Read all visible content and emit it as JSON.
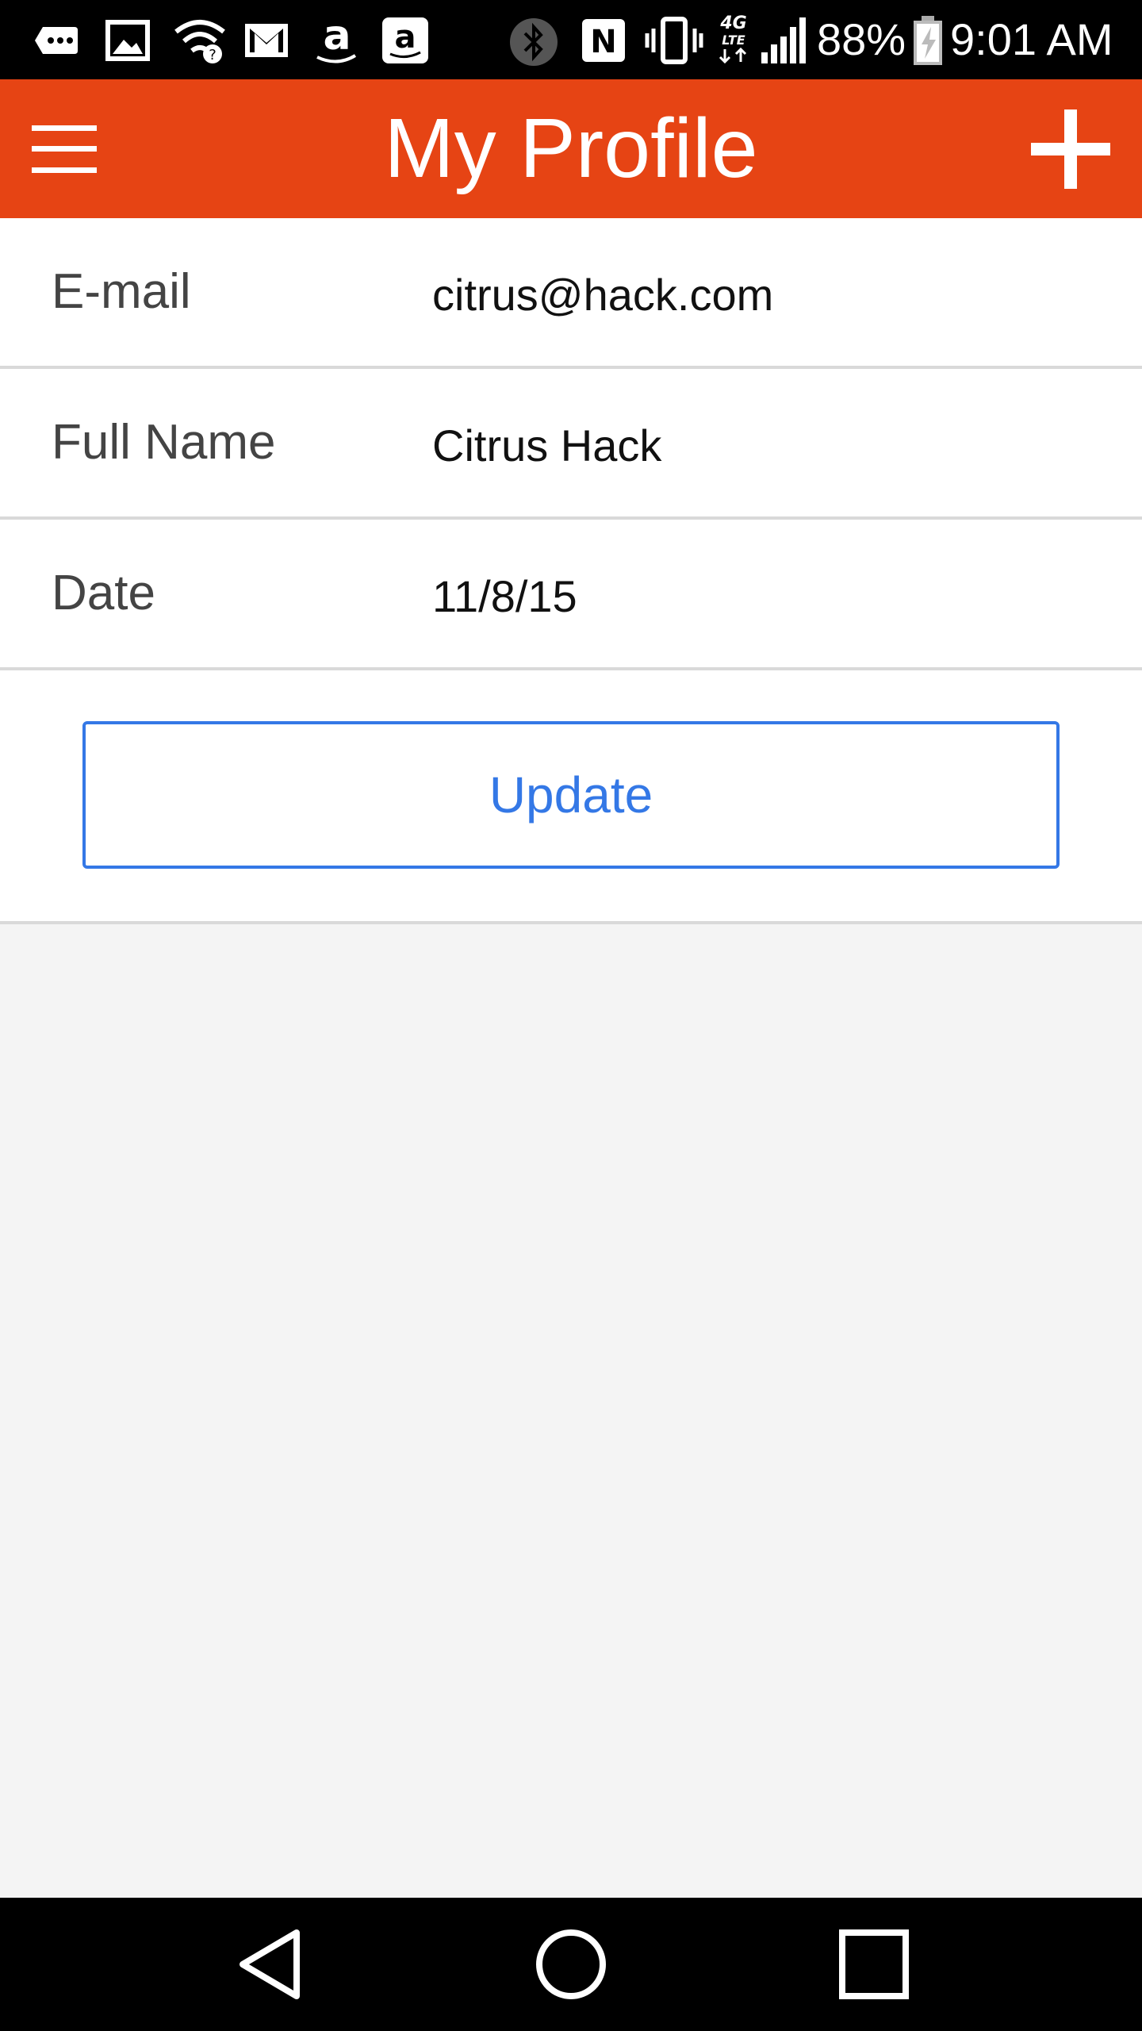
{
  "status_bar": {
    "battery": "88%",
    "time": "9:01 AM",
    "network": "4G LTE",
    "icons": [
      "chat-bubble-icon",
      "gallery-icon",
      "wifi-question-icon",
      "gmail-icon",
      "amazon-icon",
      "amazon-app-icon",
      "bluetooth-icon",
      "nfc-icon",
      "vibrate-icon",
      "lte-icon",
      "signal-icon",
      "battery-charging-icon"
    ]
  },
  "app_bar": {
    "title": "My Profile",
    "menu_icon": "hamburger-menu-icon",
    "add_icon": "plus-icon",
    "color": "#e64414"
  },
  "profile": {
    "fields": [
      {
        "label": "E-mail",
        "value": "citrus@hack.com"
      },
      {
        "label": "Full Name",
        "value": "Citrus Hack"
      },
      {
        "label": "Date",
        "value": "11/8/15"
      }
    ],
    "update_label": "Update",
    "accent_color": "#3478e6"
  },
  "nav_bar": {
    "icons": [
      "back-icon",
      "home-icon",
      "recents-icon"
    ]
  }
}
